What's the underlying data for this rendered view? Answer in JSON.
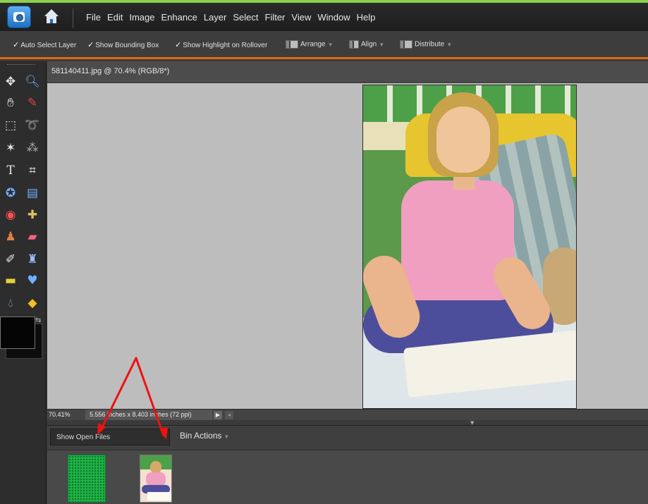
{
  "menubar": {
    "items": [
      "File",
      "Edit",
      "Image",
      "Enhance",
      "Layer",
      "Select",
      "Filter",
      "View",
      "Window",
      "Help"
    ]
  },
  "options_bar": {
    "auto_select_layer": "Auto Select Layer",
    "show_bounding_box": "Show Bounding Box",
    "show_highlight": "Show Highlight on Rollover",
    "arrange": "Arrange",
    "align": "Align",
    "distribute": "Distribute"
  },
  "toolbox": {
    "tools": [
      "move",
      "zoom",
      "hand",
      "eyedropper",
      "marquee",
      "lasso",
      "magic-wand",
      "selection-brush",
      "type",
      "crop",
      "cookie-cutter",
      "straighten",
      "red-eye",
      "healing-brush",
      "clone-stamp",
      "eraser",
      "brush",
      "paint-bucket",
      "gradient",
      "shape",
      "blur",
      "sponge"
    ],
    "foreground_color": "#050505",
    "background_color": "#0c0c0c"
  },
  "document": {
    "title": "581140411.jpg @ 70.4% (RGB/8*)"
  },
  "status_bar": {
    "zoom": "70.41%",
    "doc_size": "5.556 inches x 8.403 inches (72 ppi)"
  },
  "bin": {
    "show_files_label": "Show Open Files",
    "actions_label": "Bin Actions"
  },
  "colors": {
    "accent_orange": "#e06a10",
    "annotation_red": "#ee1111"
  }
}
